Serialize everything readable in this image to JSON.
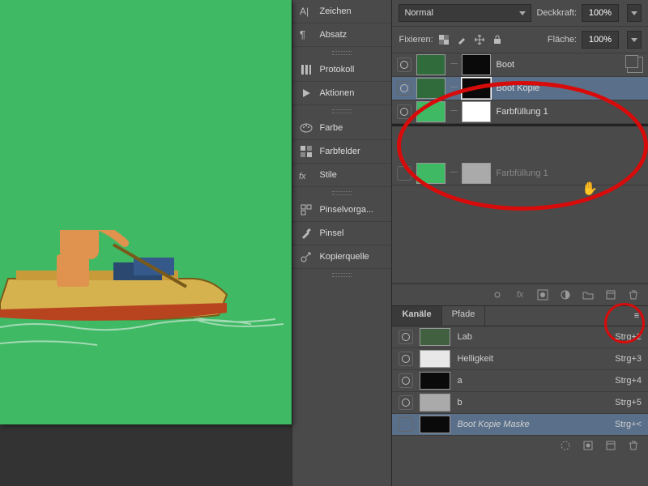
{
  "tools": {
    "zeichen": "Zeichen",
    "absatz": "Absatz",
    "protokoll": "Protokoll",
    "aktionen": "Aktionen",
    "farbe": "Farbe",
    "farbfelder": "Farbfelder",
    "stile": "Stile",
    "pinselvorgaben": "Pinselvorga...",
    "pinsel": "Pinsel",
    "kopierquelle": "Kopierquelle"
  },
  "layerOpts": {
    "blend": "Normal",
    "opacityLabel": "Deckkraft:",
    "opacity": "100%",
    "lockLabel": "Fixieren:",
    "fillLabel": "Fläche:",
    "fill": "100%"
  },
  "layers": [
    {
      "name": "Boot",
      "selected": false,
      "mask": "dark"
    },
    {
      "name": "Boot Kopie",
      "selected": true,
      "mask": "dark"
    },
    {
      "name": "Farbfüllung 1",
      "selected": false,
      "solid": "green",
      "mask": "white"
    },
    {
      "name": "Farbfüllung 1",
      "selected": false,
      "solid": "green",
      "mask": "gray",
      "dim": true
    }
  ],
  "channels": {
    "tabA": "Kanäle",
    "tabB": "Pfade",
    "list": [
      {
        "name": "Lab",
        "key": "Strg+2",
        "thumb": "green"
      },
      {
        "name": "Helligkeit",
        "key": "Strg+3",
        "thumb": "white"
      },
      {
        "name": "a",
        "key": "Strg+4",
        "thumb": "dark"
      },
      {
        "name": "b",
        "key": "Strg+5",
        "thumb": "mid"
      },
      {
        "name": "Boot Kopie Maske",
        "key": "Strg+<",
        "thumb": "dark",
        "selected": true,
        "italic": true
      }
    ]
  }
}
